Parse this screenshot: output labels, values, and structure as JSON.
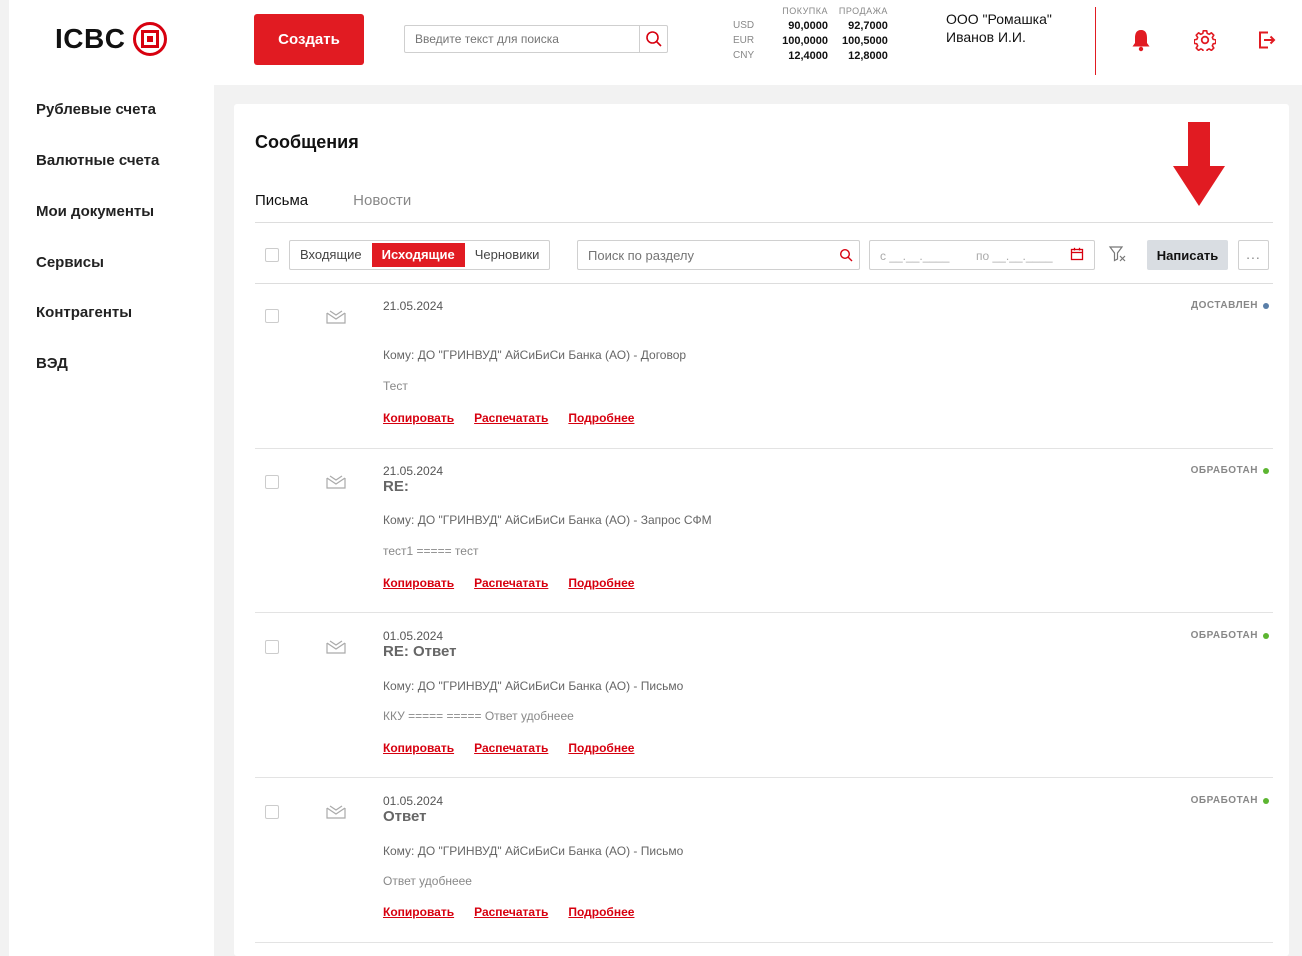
{
  "header": {
    "logo_text": "ICBC",
    "create_label": "Создать",
    "search_placeholder": "Введите текст для поиска",
    "rates": {
      "buy_label": "ПОКУПКА",
      "sell_label": "ПРОДАЖА",
      "rows": [
        {
          "currency": "USD",
          "buy": "90,0000",
          "sell": "92,7000"
        },
        {
          "currency": "EUR",
          "buy": "100,0000",
          "sell": "100,5000"
        },
        {
          "currency": "CNY",
          "buy": "12,4000",
          "sell": "12,8000"
        }
      ]
    },
    "org_name": "ООО \"Ромашка\"",
    "user_name": "Иванов И.И.",
    "accent_color": "#e11b22"
  },
  "sidebar": {
    "items": [
      {
        "label": "Рублевые счета"
      },
      {
        "label": "Валютные счета"
      },
      {
        "label": "Мои документы"
      },
      {
        "label": "Сервисы"
      },
      {
        "label": "Контрагенты"
      },
      {
        "label": "ВЭД"
      }
    ]
  },
  "main": {
    "title": "Сообщения",
    "tabs": [
      {
        "label": "Письма",
        "active": true
      },
      {
        "label": "Новости",
        "active": false
      }
    ],
    "toolbar": {
      "segments": [
        {
          "label": "Входящие"
        },
        {
          "label": "Исходящие",
          "active": true
        },
        {
          "label": "Черновики"
        }
      ],
      "section_search_placeholder": "Поиск по разделу",
      "date_from": "с __.__.____",
      "date_to": "по __.__.____",
      "write_label": "Написать",
      "more_label": "..."
    },
    "actions": {
      "copy": "Копировать",
      "print": "Распечатать",
      "details": "Подробнее"
    },
    "messages": [
      {
        "date": "21.05.2024",
        "subject": "",
        "to": "Кому: ДО \"ГРИНВУД\" АйСиБиСи Банка (АО) - Договор",
        "body": "Тест",
        "status": "ДОСТАВЛЕН",
        "status_color": "#5a7fa8"
      },
      {
        "date": "21.05.2024",
        "subject": "RE:",
        "to": "Кому: ДО \"ГРИНВУД\" АйСиБиСи Банка (АО) - Запрос СФМ",
        "body": "тест1 ===== тест",
        "status": "ОБРАБОТАН",
        "status_color": "#5cb531"
      },
      {
        "date": "01.05.2024",
        "subject": "RE: Ответ",
        "to": "Кому: ДО \"ГРИНВУД\" АйСиБиСи Банка (АО) - Письмо",
        "body": "ККУ =====  ===== Ответ удобнеее",
        "status": "ОБРАБОТАН",
        "status_color": "#5cb531"
      },
      {
        "date": "01.05.2024",
        "subject": "Ответ",
        "to": "Кому: ДО \"ГРИНВУД\" АйСиБиСи Банка (АО) - Письмо",
        "body": "Ответ удобнеее",
        "status": "ОБРАБОТАН",
        "status_color": "#5cb531"
      }
    ]
  }
}
